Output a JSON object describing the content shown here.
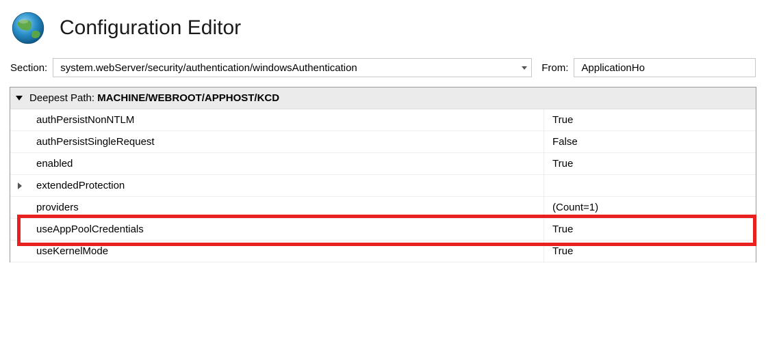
{
  "header": {
    "title": "Configuration Editor"
  },
  "sectionBar": {
    "sectionLabel": "Section:",
    "sectionValue": "system.webServer/security/authentication/windowsAuthentication",
    "fromLabel": "From:",
    "fromValue": "ApplicationHo"
  },
  "grid": {
    "headerPrefix": "Deepest Path: ",
    "headerPath": "MACHINE/WEBROOT/APPHOST/KCD",
    "rows": [
      {
        "name": "authPersistNonNTLM",
        "value": "True",
        "expandable": false
      },
      {
        "name": "authPersistSingleRequest",
        "value": "False",
        "expandable": false
      },
      {
        "name": "enabled",
        "value": "True",
        "expandable": false
      },
      {
        "name": "extendedProtection",
        "value": "",
        "expandable": true
      },
      {
        "name": "providers",
        "value": "(Count=1)",
        "expandable": false
      },
      {
        "name": "useAppPoolCredentials",
        "value": "True",
        "expandable": false
      },
      {
        "name": "useKernelMode",
        "value": "True",
        "expandable": false
      }
    ]
  }
}
